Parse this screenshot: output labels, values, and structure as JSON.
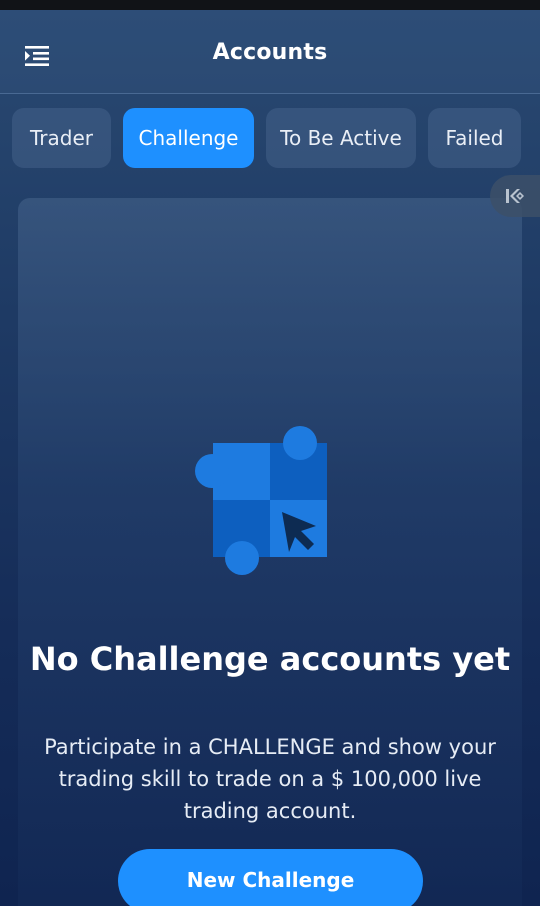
{
  "header": {
    "title": "Accounts",
    "menu_icon": "menu-icon"
  },
  "tabs": [
    {
      "label": "Trader",
      "active": false
    },
    {
      "label": "Challenge",
      "active": true
    },
    {
      "label": "To Be Active",
      "active": false
    },
    {
      "label": "Failed",
      "active": false
    }
  ],
  "side_widget": {
    "icon": "brand-logo-icon"
  },
  "empty_state": {
    "illustration_icon": "puzzle-cursor-icon",
    "title": "No Challenge accounts yet",
    "description": "Participate in a CHALLENGE and show your trading skill to trade on a $ 100,000 live trading account.",
    "button_label": "New Challenge"
  },
  "colors": {
    "accent": "#1e90ff",
    "background_top": "#2a4a72",
    "background_bottom": "#0f2450"
  }
}
